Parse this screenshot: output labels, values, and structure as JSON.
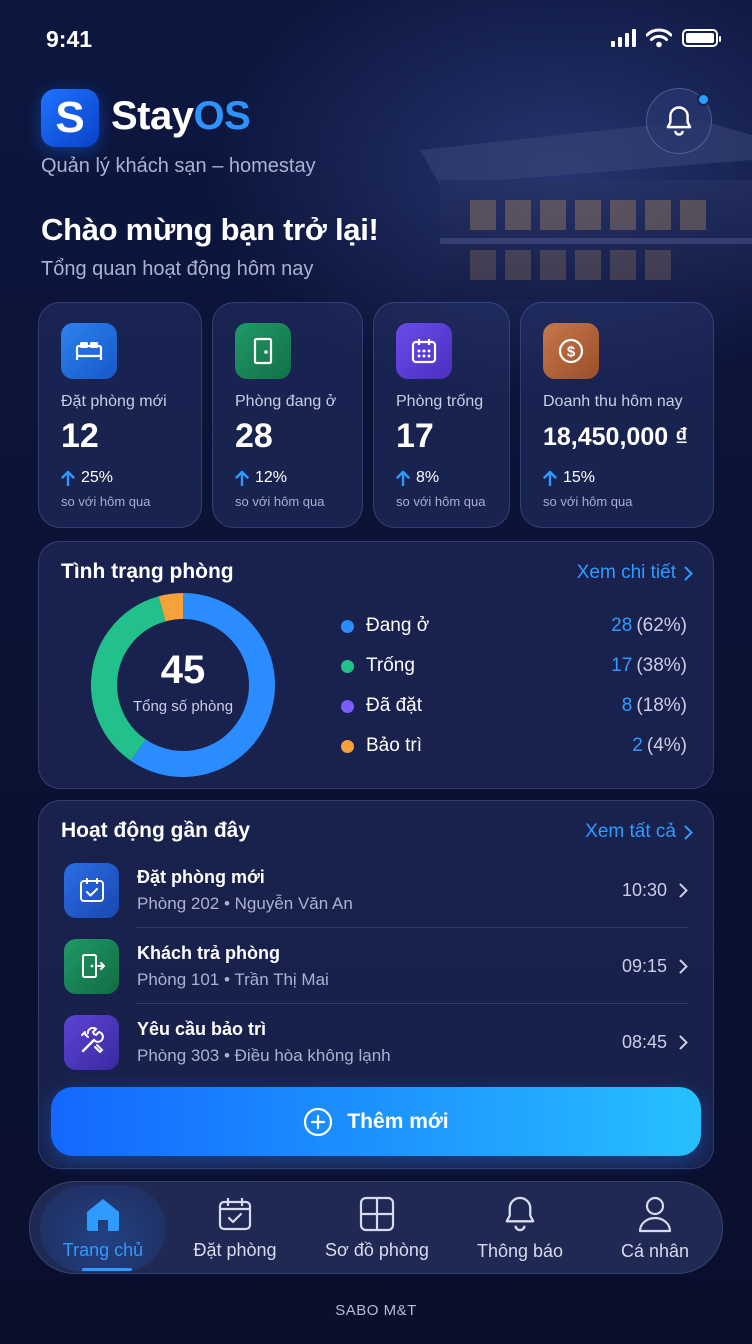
{
  "status_bar": {
    "time": "9:41"
  },
  "header": {
    "logo_letter": "S",
    "brand_main": "Stay",
    "brand_accent": "OS",
    "tagline": "Quản lý khách sạn – homestay",
    "notification_badge": true
  },
  "welcome": {
    "title": "Chào mừng bạn trở lại!",
    "subtitle": "Tổng quan hoạt động hôm nay"
  },
  "stats": [
    {
      "icon": "bed-icon",
      "color": "#1e6fe0",
      "label": "Đặt phòng mới",
      "value": "12",
      "change": "25%",
      "sub": "so với hôm qua"
    },
    {
      "icon": "door-icon",
      "color": "#1a8a5a",
      "label": "Phòng đang ở",
      "value": "28",
      "change": "12%",
      "sub": "so với hôm qua"
    },
    {
      "icon": "calendar-grid-icon",
      "color": "#5b3fd6",
      "label": "Phòng trống",
      "value": "17",
      "change": "8%",
      "sub": "so với hôm qua"
    },
    {
      "icon": "dollar-coin-icon",
      "color": "#b8663a",
      "label": "Doanh thu hôm nay",
      "value": "18,450,000 ₫",
      "change": "15%",
      "sub": "so với hôm qua"
    }
  ],
  "room_status": {
    "title": "Tình trạng phòng",
    "link": "Xem chi tiết",
    "total": "45",
    "total_label": "Tổng số phòng",
    "items": [
      {
        "label": "Đang ở",
        "count": "28",
        "pct": "(62%)",
        "color": "#2a8cff",
        "value": 28
      },
      {
        "label": "Trống",
        "count": "17",
        "pct": "(38%)",
        "color": "#22c08a",
        "value": 17
      },
      {
        "label": "Đã đặt",
        "count": "8",
        "pct": "(18%)",
        "color": "#7a5cff",
        "value": 8
      },
      {
        "label": "Bảo trì",
        "count": "2",
        "pct": "(4%)",
        "color": "#f5a23a",
        "value": 2
      }
    ]
  },
  "activity": {
    "title": "Hoạt động gần đây",
    "link": "Xem tất cả",
    "items": [
      {
        "icon": "calendar-check-icon",
        "color": "#1f5bd0",
        "title": "Đặt phòng mới",
        "desc": "Phòng 202 • Nguyễn Văn An",
        "time": "10:30"
      },
      {
        "icon": "door-exit-icon",
        "color": "#168055",
        "title": "Khách trả phòng",
        "desc": "Phòng 101 • Trần Thị Mai",
        "time": "09:15"
      },
      {
        "icon": "tools-icon",
        "color": "#4a36b8",
        "title": "Yêu cầu bảo trì",
        "desc": "Phòng 303 • Điều hòa không lạnh",
        "time": "08:45"
      }
    ]
  },
  "add_button": {
    "label": "Thêm mới"
  },
  "nav": {
    "items": [
      {
        "icon": "home-icon",
        "label": "Trang chủ",
        "active": true
      },
      {
        "icon": "calendar-icon",
        "label": "Đặt phòng",
        "active": false
      },
      {
        "icon": "grid-icon",
        "label": "Sơ đồ phòng",
        "active": false
      },
      {
        "icon": "bell-icon",
        "label": "Thông báo",
        "active": false
      },
      {
        "icon": "user-icon",
        "label": "Cá nhân",
        "active": false
      }
    ]
  },
  "footer": {
    "text": "SABO M&T"
  }
}
